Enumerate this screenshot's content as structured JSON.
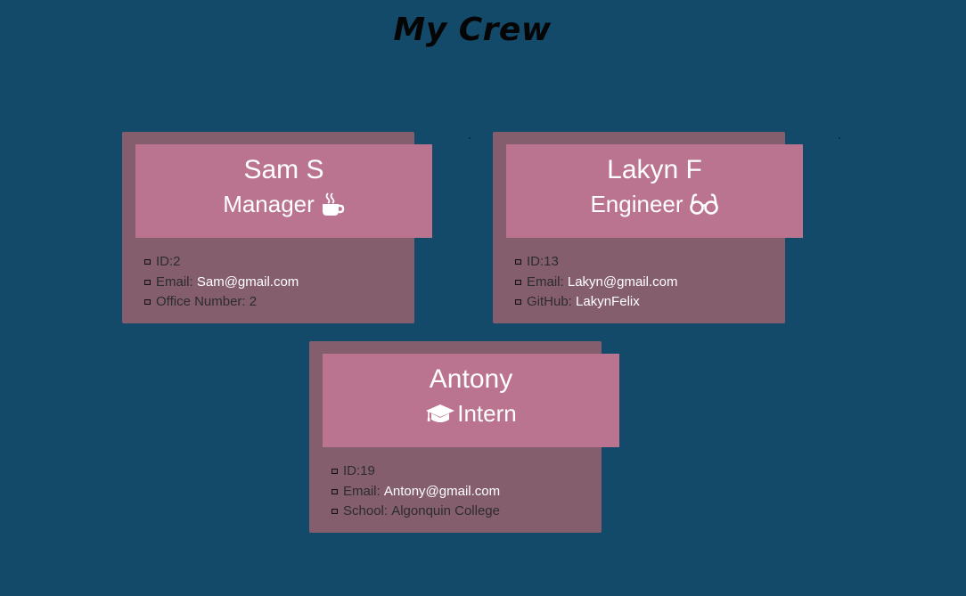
{
  "header": {
    "title": "My Crew"
  },
  "employees": [
    {
      "name": "Sam S",
      "role": "Manager",
      "role_icon": "coffee-icon",
      "id_label": "ID: ",
      "id": "2",
      "email_label": "Email: ",
      "email": "Sam@gmail.com",
      "extra_label": "Office Number: ",
      "extra_value": "2"
    },
    {
      "name": "Lakyn F",
      "role": "Engineer",
      "role_icon": "glasses-icon",
      "id_label": "ID: ",
      "id": "13",
      "email_label": "Email: ",
      "email": "Lakyn@gmail.com",
      "extra_label": "GitHub: ",
      "extra_value": "LakynFelix"
    },
    {
      "name": "Antony",
      "role": "Intern",
      "role_icon": "graduation-cap-icon",
      "id_label": "ID: ",
      "id": "19",
      "email_label": "Email: ",
      "email": "Antony@gmail.com",
      "extra_label": "School: ",
      "extra_value": "Algonquin College"
    }
  ],
  "colors": {
    "background": "#134a6a",
    "card_body": "#855e6e",
    "card_header": "#bb748f",
    "link": "#ffffff"
  }
}
